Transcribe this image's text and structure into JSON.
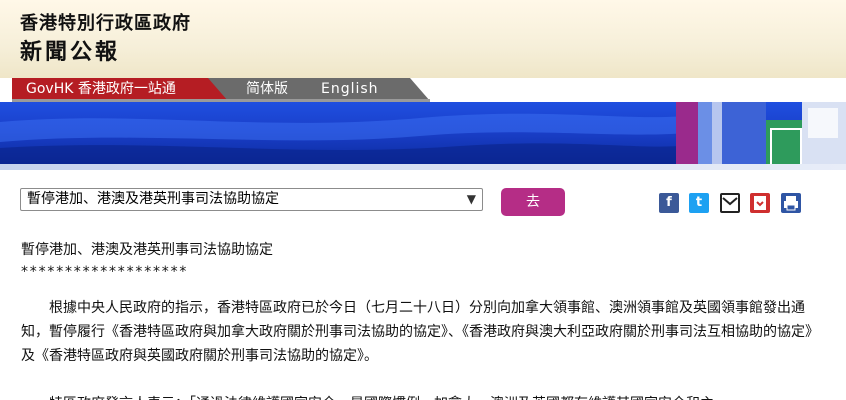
{
  "masthead": {
    "org": "香港特別行政區政府",
    "title": "新聞公報"
  },
  "nav": {
    "govhk": "GovHK 香港政府一站通",
    "simplified": "简体版",
    "english": "English"
  },
  "controls": {
    "selected_topic": "暫停港加、港澳及港英刑事司法協助協定",
    "go_label": "去"
  },
  "share": {
    "facebook": "f",
    "twitter": "t",
    "email": "✉",
    "bookmark": "♥",
    "print": "⎙"
  },
  "article": {
    "headline": "暫停港加、港澳及港英刑事司法協助協定",
    "stars": "*******************",
    "paragraph1": "根據中央人民政府的指示，香港特區政府已於今日（七月二十八日）分別向加拿大領事館、澳洲領事館及英國領事館發出通知，暫停履行《香港特區政府與加拿大政府關於刑事司法協助的協定》、《香港政府與澳大利亞政府關於刑事司法互相協助的協定》及《香港特區政府與英國政府關於刑事司法協助的協定》。",
    "paragraph2": "特區政府發言人表示：「通過法律維護國家安全，是國際慣例。加拿大、澳洲及英國都有維護其國家安全和主"
  },
  "icons": [
    "facebook-icon",
    "twitter-icon",
    "email-icon",
    "bookmark-icon",
    "print-icon",
    "chevron-down-icon"
  ],
  "colors": {
    "govhk_red": "#b51d23",
    "go_button": "#b52d86",
    "banner_blue": "#1a3fc9",
    "nav_grey": "#6b6b6b"
  }
}
